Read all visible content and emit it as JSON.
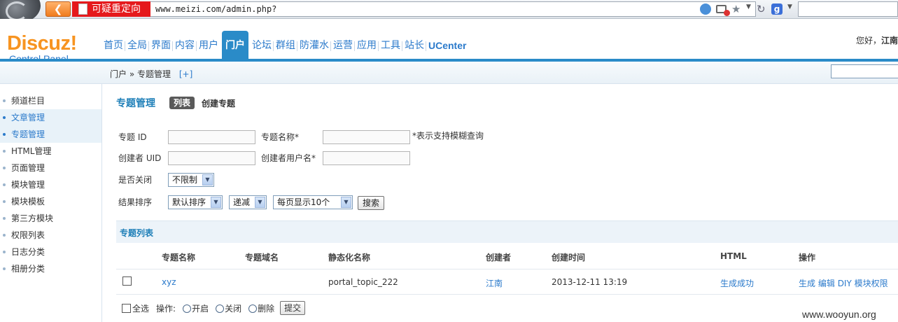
{
  "browser": {
    "redirect_warning": "可疑重定向",
    "url": "www.meizi.com/admin.php?",
    "search_engine_icon": "g-icon"
  },
  "header": {
    "logo_title": "Discuz!",
    "logo_subtitle": "Control Panel",
    "nav": [
      "首页",
      "全局",
      "界面",
      "内容",
      "用户",
      "门户",
      "论坛",
      "群组",
      "防灌水",
      "运营",
      "应用",
      "工具",
      "站长",
      "UCenter"
    ],
    "active_nav": "门户",
    "greeting": "您好，",
    "username": "江南"
  },
  "breadcrumb": {
    "section": "门户",
    "separator": "»",
    "page": "专题管理",
    "add": "[+]"
  },
  "sidebar": {
    "items": [
      "频道栏目",
      "文章管理",
      "专题管理",
      "HTML管理",
      "页面管理",
      "模块管理",
      "模块模板",
      "第三方模块",
      "权限列表",
      "日志分类",
      "相册分类"
    ],
    "highlighted": [
      "文章管理",
      "专题管理"
    ]
  },
  "main": {
    "title": "专题管理",
    "tab_list": "列表",
    "tab_create": "创建专题",
    "form": {
      "topic_id_label": "专题 ID",
      "topic_name_label": "专题名称*",
      "fuzzy_hint": "*表示支持模糊查询",
      "creator_uid_label": "创建者 UID",
      "creator_username_label": "创建者用户名*",
      "closed_label": "是否关闭",
      "closed_value": "不限制",
      "order_label": "结果排序",
      "order_value": "默认排序",
      "direction_value": "递减",
      "perpage_value": "每页显示10个",
      "search_button": "搜索"
    },
    "list": {
      "heading": "专题列表",
      "columns": [
        "专题名称",
        "专题域名",
        "静态化名称",
        "创建者",
        "创建时间",
        "HTML",
        "操作"
      ],
      "rows": [
        {
          "name": "xyz",
          "domain": "",
          "static_name": "portal_topic_222",
          "creator": "江南",
          "created": "2013-12-11 13:19",
          "html": "生成成功",
          "ops": [
            "生成",
            "编辑",
            "DIY",
            "模块权限"
          ]
        }
      ],
      "select_all": "全选",
      "action_label": "操作:",
      "action_open": "开启",
      "action_close": "关闭",
      "action_delete": "删除",
      "submit": "提交"
    }
  },
  "watermark": "www.wooyun.org"
}
